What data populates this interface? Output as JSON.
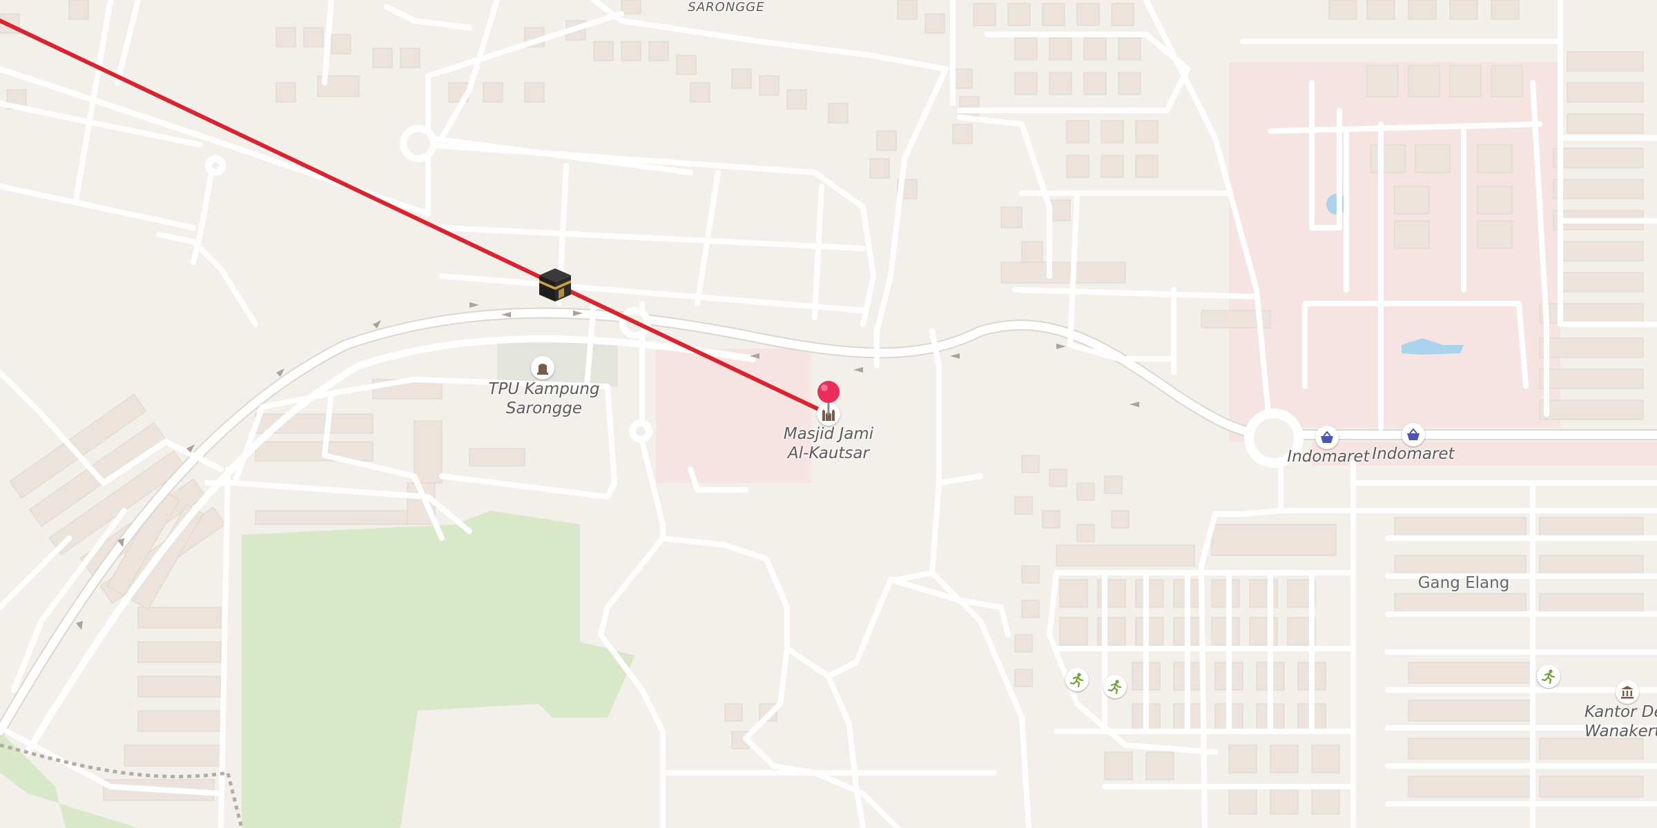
{
  "map": {
    "neighborhood_label": "SARONGGE",
    "area_label": "Gang Elang",
    "colors": {
      "land": "#f3f0ec",
      "road": "#ffffff",
      "road_casing": "#dcd6d0",
      "building": "#ece4dc",
      "building_edge": "#ded4ca",
      "park": "#d9e8c8",
      "retail_zone": "#f6e4e2",
      "water": "#a9d3ec",
      "qibla_line": "#d9232e",
      "pin": "#ea2d59"
    },
    "route_line": {
      "name": "qibla-direction-line",
      "from_icon": "kaaba-icon",
      "to": "Masjid Jami Al-Kautsar"
    },
    "pois": [
      {
        "id": "cemetery",
        "icon": "grave-icon",
        "name_line1": "TPU Kampung",
        "name_line2": "Sarongge"
      },
      {
        "id": "mosque",
        "icon": "mosque-icon",
        "name_line1": "Masjid Jami",
        "name_line2": "Al-Kautsar"
      },
      {
        "id": "indomaret1",
        "icon": "shopping-basket-icon",
        "name": "Indomaret"
      },
      {
        "id": "indomaret2",
        "icon": "shopping-basket-icon",
        "name": "Indomaret"
      },
      {
        "id": "office",
        "icon": "town-hall-icon",
        "name_line1": "Kantor Desa",
        "name_line2": "Wanakerta"
      },
      {
        "id": "sport1",
        "icon": "running-icon"
      },
      {
        "id": "sport2",
        "icon": "running-icon"
      },
      {
        "id": "sport3",
        "icon": "running-icon"
      }
    ]
  }
}
